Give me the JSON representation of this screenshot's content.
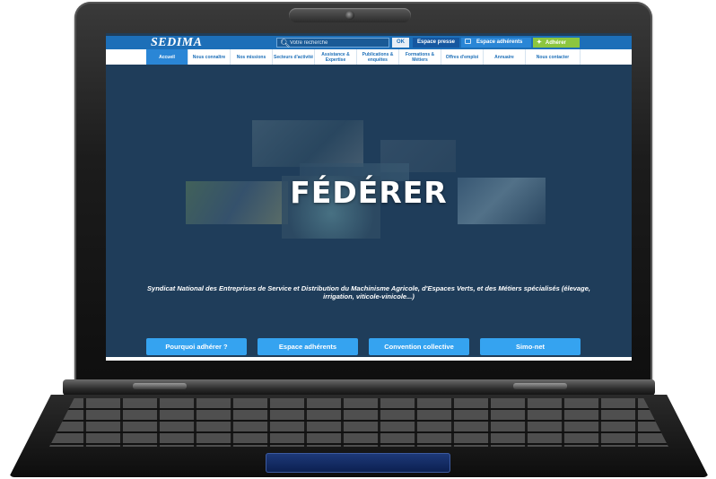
{
  "header": {
    "logo": "SEDIMA",
    "search": {
      "placeholder": "Votre recherche",
      "submit_label": "OK"
    },
    "press_label": "Espace presse",
    "members_label": "Espace adhérents",
    "join_label": "Adhérer"
  },
  "nav": {
    "items": [
      {
        "label": "Accueil",
        "active": true
      },
      {
        "label": "Nous connaître"
      },
      {
        "label": "Nos missions"
      },
      {
        "label": "Secteurs d'activité"
      },
      {
        "label": "Assistance & Expertise"
      },
      {
        "label": "Publications & enquêtes"
      },
      {
        "label": "Formations & Métiers"
      },
      {
        "label": "Offres d'emploi"
      },
      {
        "label": "Annuaire"
      },
      {
        "label": "Nous contacter"
      }
    ]
  },
  "hero": {
    "title": "FÉDÉRER",
    "subtitle": "Syndicat National des Entreprises de Service et Distribution du Machinisme Agricole, d'Espaces Verts, et des Métiers spécialisés (élevage, irrigation, viticole-vinicole...)"
  },
  "cta": {
    "why_join": "Pourquoi adhérer ?",
    "members_area": "Espace adhérents",
    "collective_agreement": "Convention collective",
    "simo_net": "Simo-net"
  },
  "colors": {
    "brand_blue": "#1d6fb8",
    "hero_bg": "#1f3d5a",
    "cta_blue": "#35a3f0",
    "join_green": "#8cc63f"
  }
}
